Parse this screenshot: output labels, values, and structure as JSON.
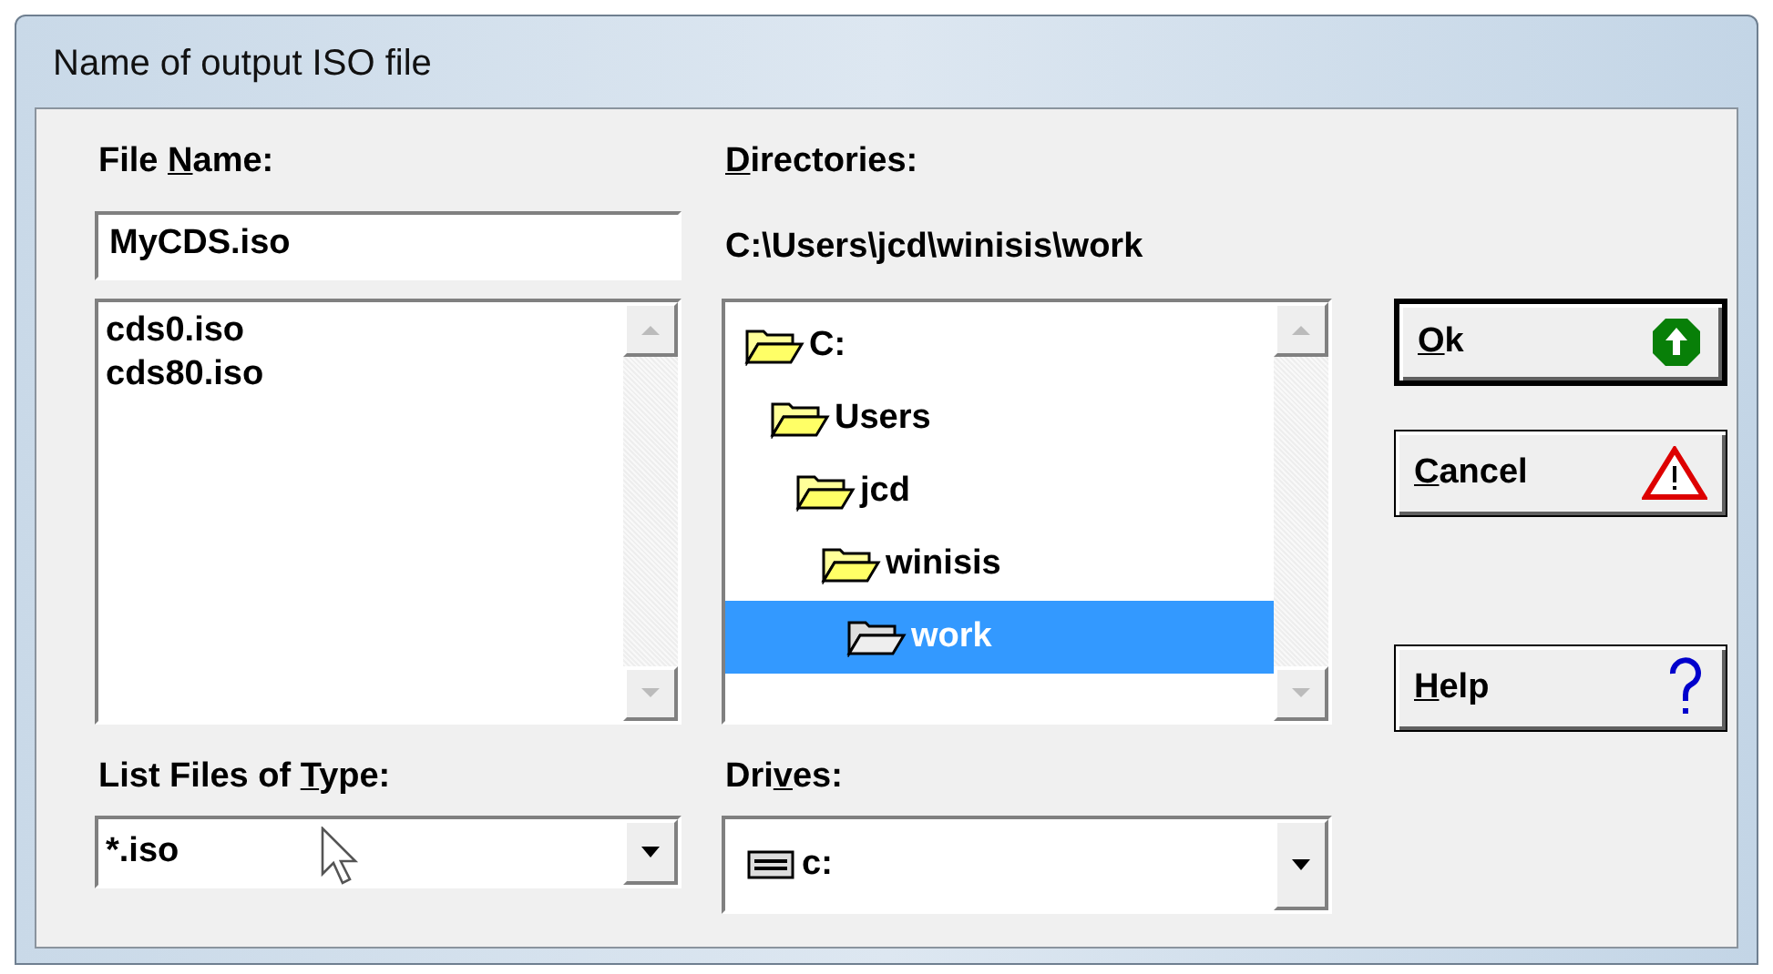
{
  "window": {
    "title": "Name of output ISO file"
  },
  "file_name": {
    "label": {
      "pre": "File ",
      "key": "N",
      "post": "ame:"
    },
    "value": "MyCDS.iso"
  },
  "files": [
    {
      "name": "cds0.iso",
      "selected": false
    },
    {
      "name": "cds80.iso",
      "selected": false
    }
  ],
  "file_type": {
    "label": {
      "pre": "List Files of ",
      "key": "T",
      "post": "ype:"
    },
    "value": "*.iso"
  },
  "directories": {
    "label": {
      "key": "D",
      "post": "irectories:"
    },
    "path": "C:\\Users\\jcd\\winisis\\work",
    "tree": [
      {
        "name": "C:",
        "selected": false,
        "children": [
          {
            "name": "Users",
            "selected": false,
            "children": [
              {
                "name": "jcd",
                "selected": false,
                "children": [
                  {
                    "name": "winisis",
                    "selected": false,
                    "children": [
                      {
                        "name": "work",
                        "selected": true
                      }
                    ]
                  }
                ]
              }
            ]
          }
        ]
      }
    ]
  },
  "drives": {
    "label": {
      "pre": "Dri",
      "key": "v",
      "post": "es:"
    },
    "value": "c:"
  },
  "buttons": [
    {
      "kind": "ok",
      "label": {
        "key": "O",
        "post": "k"
      },
      "default": true
    },
    {
      "kind": "cancel",
      "label": {
        "key": "C",
        "post": "ancel"
      },
      "default": false
    },
    {
      "kind": "help",
      "label": {
        "key": "H",
        "post": "elp"
      },
      "default": false
    }
  ]
}
